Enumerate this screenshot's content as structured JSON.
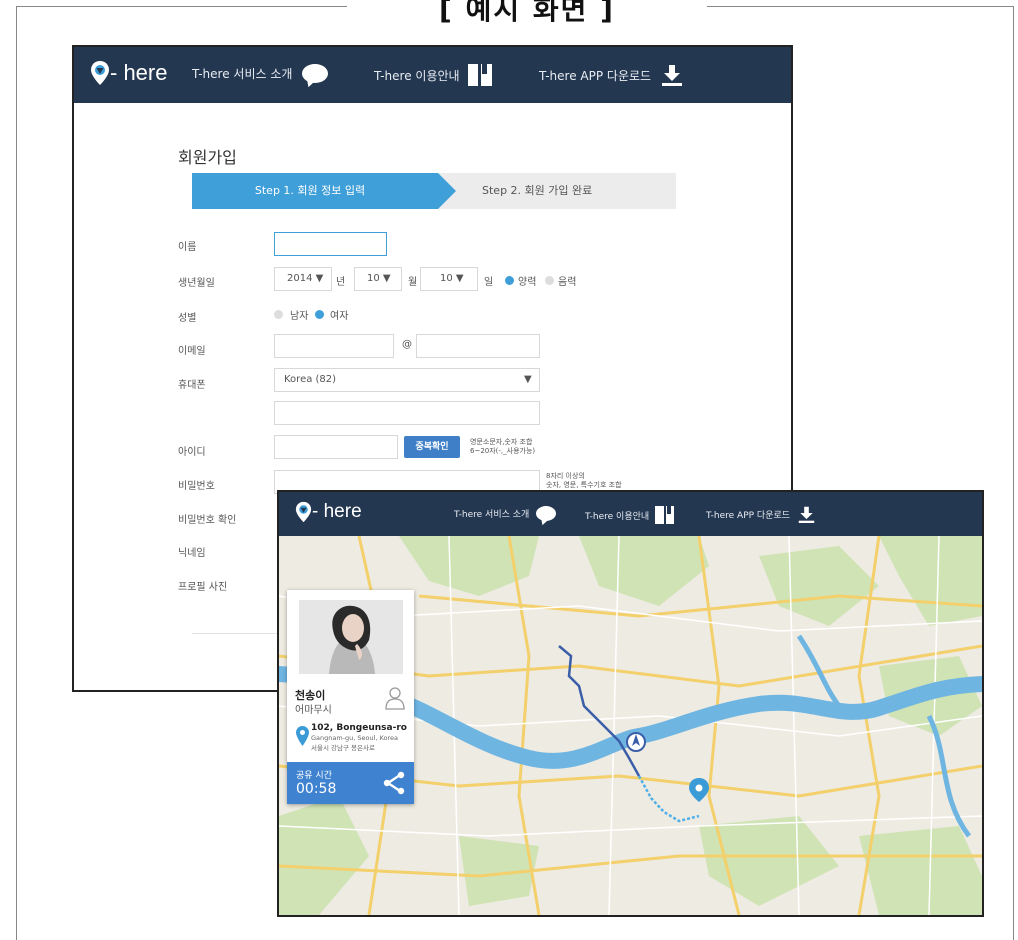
{
  "page_title": "[ 예시 화면 ]",
  "nav": {
    "logo_text": "- here",
    "items": [
      {
        "label": "T-here 서비스 소개",
        "icon": "chat-bubble-icon"
      },
      {
        "label": "T-here 이용안내",
        "icon": "book-icon"
      },
      {
        "label": "T-here APP 다운로드",
        "icon": "download-icon"
      }
    ]
  },
  "signup": {
    "title": "회원가입",
    "step1": "Step 1. 회원 정보 입력",
    "step2": "Step 2. 회원 가입 완료",
    "labels": {
      "name": "이름",
      "birth": "생년월일",
      "gender": "성별",
      "email": "이메일",
      "phone": "휴대폰",
      "id": "아이디",
      "password": "비밀번호",
      "password_confirm": "비밀번호 확인",
      "nickname": "닉네임",
      "profile_photo": "프로필 사진"
    },
    "birth": {
      "year": "2014 ▼",
      "year_unit": "년",
      "month": "10 ▼",
      "month_unit": "월",
      "day": "10 ▼",
      "day_unit": "일",
      "solar": "양력",
      "lunar": "음력",
      "selected": "solar"
    },
    "gender": {
      "male": "남자",
      "female": "여자",
      "selected": "female"
    },
    "email_at": "@",
    "phone_country": "Korea (82)",
    "phone_dropdown_arrow": "▼",
    "id_check_button": "중복확인",
    "id_hint_line1": "영문소문자,숫자 조합",
    "id_hint_line2": "6~20자(-,_사용가능)",
    "password_hint_line1": "8자리 이상의",
    "password_hint_line2": "숫자, 영문, 특수기호 조합"
  },
  "profile_card": {
    "name": "천송이",
    "status": "어마무시",
    "address_line1": "102, Bongeunsa-ro",
    "address_line2": "Gangnam-gu, Seoul, Korea",
    "address_line3": "서울시 강남구 봉은사로",
    "share_label": "공유 시간",
    "share_time": "00:58"
  },
  "colors": {
    "nav_bg": "#243750",
    "accent_blue": "#3f9fd8",
    "share_blue": "#3f82cf",
    "pin_blue": "#3b9bd6"
  }
}
